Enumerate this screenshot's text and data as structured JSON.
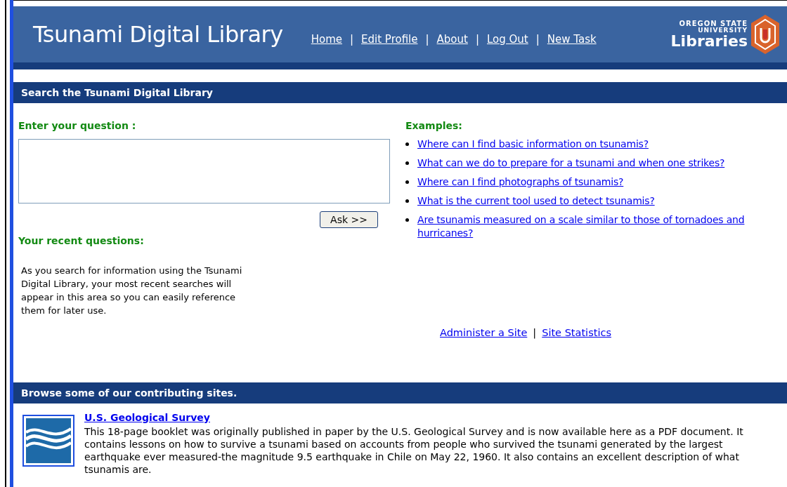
{
  "header": {
    "title": "Tsunami Digital Library",
    "nav": [
      {
        "kind": "link",
        "text": "Home"
      },
      {
        "kind": "separator",
        "text": "|"
      },
      {
        "kind": "link",
        "text": "Edit Profile"
      },
      {
        "kind": "separator",
        "text": "|"
      },
      {
        "kind": "link",
        "text": "About"
      },
      {
        "kind": "separator",
        "text": "|"
      },
      {
        "kind": "link",
        "text": "Log Out"
      },
      {
        "kind": "separator",
        "text": "|"
      },
      {
        "kind": "link",
        "text": "New Task"
      }
    ],
    "logo": {
      "line_1": "OREGON STATE",
      "line_2": "UNIVERSITY",
      "line_3": "Libraries"
    }
  },
  "search_section": {
    "title": "Search the Tsunami Digital Library",
    "question_label": "Enter your question :",
    "ask_button": "Ask >>",
    "recent_label": "Your recent questions:",
    "recent_text": "As you search for information using the Tsunami Digital Library, your most recent searches will appear in this area so you can easily reference them for later use.",
    "examples_label": "Examples:",
    "examples": [
      "Where can I find basic information on tsunamis?",
      "What can we do to prepare for a tsunami and when one strikes?",
      "Where can I find photographs of tsunamis?",
      "What is the current tool used to detect tsunamis?",
      "Are tsunamis measured on a scale similar to those of tornadoes and hurricanes?"
    ],
    "admin_links": [
      {
        "kind": "link",
        "text": "Administer a Site"
      },
      {
        "kind": "separator",
        "text": "|"
      },
      {
        "kind": "link",
        "text": "Site Statistics"
      }
    ]
  },
  "browse_section": {
    "title": "Browse some of our contributing sites.",
    "sites": [
      {
        "name": "U.S. Geological Survey",
        "description": "This 18-page booklet was originally published in paper by the U.S. Geological Survey and is now available here as a PDF document. It contains lessons on how to survive a tsunami based on accounts from people who survived the tsunami generated by the largest earthquake ever measured-the magnitude 9.5 earthquake in Chile on May 22, 1960. It also contains an excellent description of what tsunamis are."
      }
    ]
  }
}
